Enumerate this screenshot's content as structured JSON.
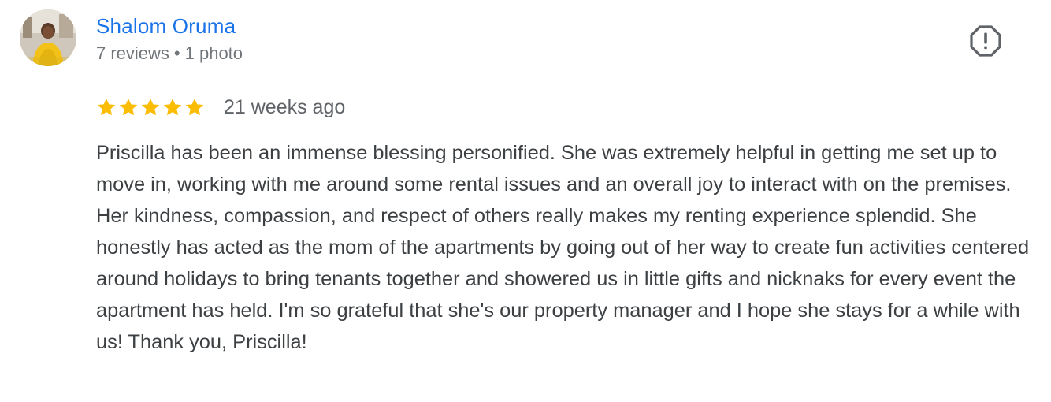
{
  "review": {
    "author": {
      "name": "Shalom Oruma",
      "reviews_count": "7 reviews",
      "separator": "•",
      "photos_count": "1 photo",
      "avatar_icon": "user-photo"
    },
    "rating": {
      "stars": 5,
      "max_stars": 5,
      "star_color": "#fbbc04"
    },
    "date": "21 weeks ago",
    "flag_icon": "report-exclamation-icon",
    "text": "Priscilla has been an immense blessing personified. She was extremely helpful in getting me set up to move in, working with me around some rental issues and an overall joy to interact with on the premises. Her kindness, compassion, and respect of others really makes my renting experience splendid. She honestly has acted as the mom of the apartments by going out of her way to create fun activities centered around holidays to bring tenants together and showered us in little gifts and nicknaks for every event the apartment has held. I'm so grateful that she's our property manager and I hope she stays for a while with us! Thank you, Priscilla!"
  },
  "colors": {
    "link_blue": "#1a73e8",
    "meta_gray": "#70757a",
    "text": "#3c4043",
    "icon_gray": "#5f6368"
  }
}
